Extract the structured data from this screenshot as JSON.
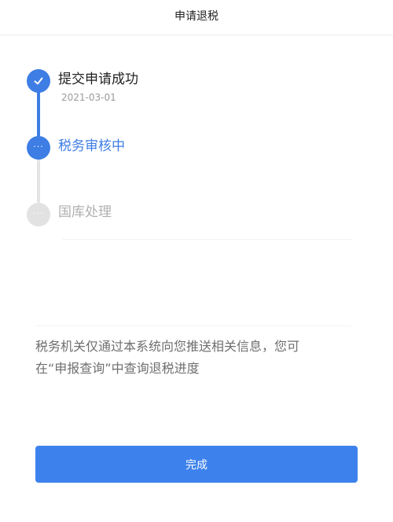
{
  "header": {
    "title": "申请退税"
  },
  "timeline": {
    "steps": [
      {
        "label": "提交申请成功",
        "date": "2021-03-01",
        "status": "done",
        "icon": "check-icon"
      },
      {
        "label": "税务审核中",
        "status": "active",
        "icon": "ellipsis-icon",
        "dots": "···"
      },
      {
        "label": "国库处理",
        "status": "pending",
        "icon": "ellipsis-icon",
        "dots": "···"
      }
    ]
  },
  "notice": {
    "line1": "税务机关仅通过本系统向您推送相关信息，您可",
    "line2": "在“申报查询”中查询退税进度"
  },
  "footer": {
    "done_label": "完成"
  },
  "colors": {
    "accent": "#3d7de4",
    "pending": "#e2e2e2",
    "text_secondary": "#6f6f6f"
  }
}
